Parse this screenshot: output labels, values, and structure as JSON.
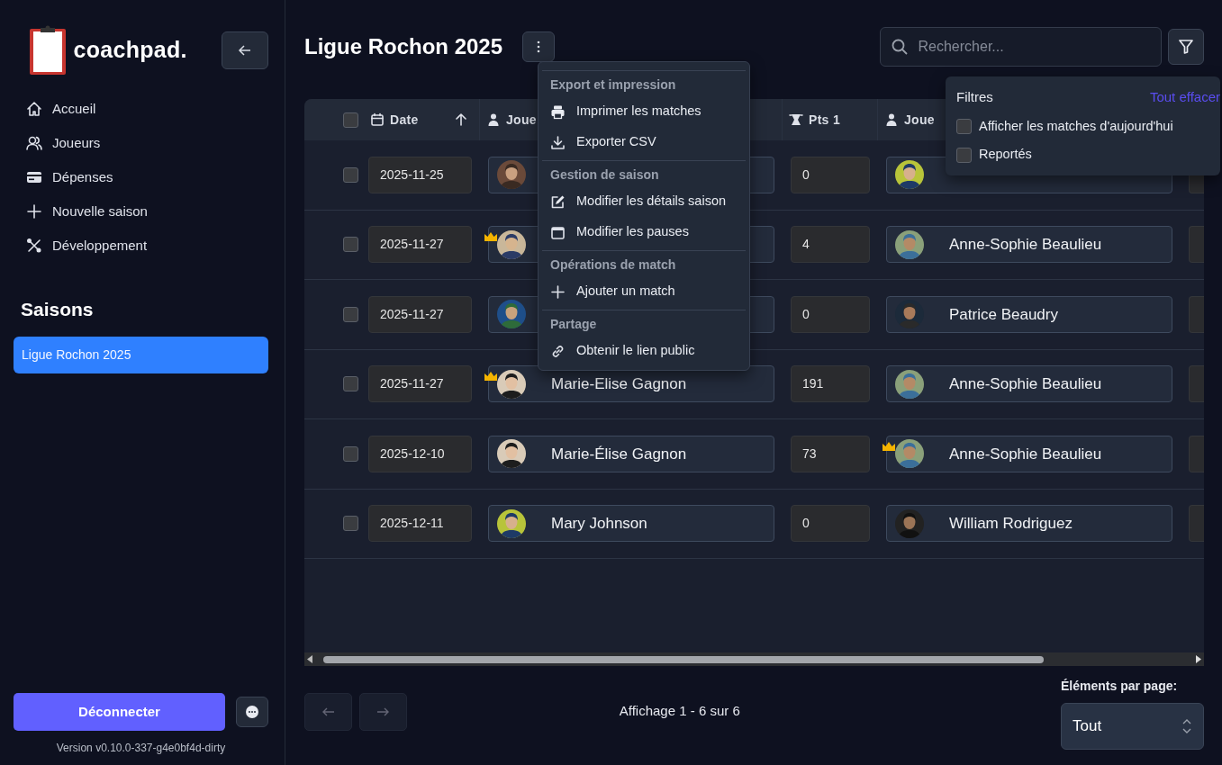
{
  "sidebar": {
    "logo": "coachpad.",
    "nav": [
      {
        "label": "Accueil"
      },
      {
        "label": "Joueurs"
      },
      {
        "label": "Dépenses"
      },
      {
        "label": "Nouvelle saison"
      },
      {
        "label": "Développement"
      }
    ],
    "seasons_title": "Saisons",
    "seasons": [
      {
        "label": "Ligue Rochon 2025",
        "selected": true
      }
    ],
    "logout": "Déconnecter",
    "version": "Version v0.10.0-337-g4e0bf4d-dirty"
  },
  "header": {
    "title": "Ligue Rochon 2025",
    "search": {
      "placeholder": "Rechercher..."
    }
  },
  "table": {
    "all_checked": false,
    "columns": [
      {
        "label": "Date",
        "sorted_ascending": true
      },
      {
        "label": "Joue"
      },
      {
        "label": "Pts 1"
      },
      {
        "label": "Joue"
      }
    ],
    "rows": [
      {
        "checked": false,
        "date": "2025-11-25",
        "player_1": {
          "crown": false
        },
        "pts_1": "0",
        "player_2": {
          "crown": false
        }
      },
      {
        "checked": false,
        "date": "2025-11-27",
        "player_1": {
          "crown": true
        },
        "pts_1": "4",
        "player_2": {
          "name": "Anne-Sophie Beaulieu",
          "crown": false
        }
      },
      {
        "checked": false,
        "date": "2025-11-27",
        "player_1": {
          "crown": false
        },
        "pts_1": "0",
        "player_2": {
          "name": "Patrice Beaudry",
          "crown": false
        }
      },
      {
        "checked": false,
        "date": "2025-11-27",
        "player_1": {
          "name": "Marie-Elise Gagnon",
          "crown": true
        },
        "pts_1": "191",
        "player_2": {
          "name": "Anne-Sophie Beaulieu",
          "crown": false
        }
      },
      {
        "checked": false,
        "date": "2025-12-10",
        "player_1": {
          "name": "Marie-Élise Gagnon",
          "crown": false
        },
        "pts_1": "73",
        "player_2": {
          "name": "Anne-Sophie Beaulieu",
          "crown": true
        }
      },
      {
        "checked": false,
        "date": "2025-12-11",
        "player_1": {
          "name": "Mary Johnson",
          "crown": false
        },
        "pts_1": "0",
        "player_2": {
          "name": "William Rodriguez",
          "crown": false
        }
      }
    ]
  },
  "pagination": {
    "prev_disabled": true,
    "next_disabled": true,
    "info": "Affichage 1 - 6 sur 6",
    "per_page_label": "Éléments par page:",
    "per_page": "Tout"
  },
  "menu": {
    "sections": [
      {
        "title": "Export et impression",
        "items": [
          "Imprimer les matches",
          "Exporter CSV"
        ]
      },
      {
        "title": "Gestion de saison",
        "items": [
          "Modifier les détails saison",
          "Modifier les pauses"
        ]
      },
      {
        "title": "Opérations de match",
        "items": [
          "Ajouter un match"
        ]
      },
      {
        "title": "Partage",
        "items": [
          "Obtenir le lien public"
        ]
      }
    ]
  },
  "filters": {
    "title": "Filtres",
    "clear": "Tout effacer",
    "options": [
      {
        "label": "Afficher les matches d'aujourd'hui",
        "checked": false
      },
      {
        "label": "Reportés",
        "checked": false
      }
    ]
  }
}
